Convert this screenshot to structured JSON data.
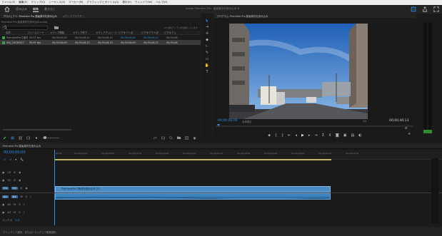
{
  "menu": [
    "ファイル(F)",
    "編集(E)",
    "クリップ(C)",
    "シーケンス(S)",
    "マーカー(M)",
    "グラフィックとタイトル(G)",
    "表示(V)",
    "ウィンドウ(W)",
    "ヘルプ(H)"
  ],
  "workspace": {
    "tabs": [
      "読み込み",
      "編集",
      "書き出し"
    ],
    "active": 1
  },
  "app_title": "Adobe Premiere Pro - 動画素材を読み込み ★",
  "project": {
    "tab": "プロジェクト: Premiere Pro 動画素材を読み込み",
    "tab2": "メディアブラウザー",
    "path": "Premiere Pro 動画素材を読み込み.prproj",
    "search_placeholder": "",
    "selected_info": "1/2 個のアイテムを選択しています",
    "columns": [
      "名前",
      "フレームレート",
      "メディア開始",
      "メディア終了",
      "メディアデュレーション",
      "ビデオイン点",
      "ビデオアウト点",
      "ビデオデュ"
    ],
    "rows": [
      {
        "name": "PremiereProで素材を読み込み",
        "color": "#2aa84a",
        "cells": [
          "29.97 fps",
          "00;00;00;00",
          "00;00;40;12",
          "00;00;40;13",
          "00;00;00;00",
          "00;00;40;12",
          "00;00;40;"
        ]
      },
      {
        "name": "VID_20230917",
        "color": "#3a9b52",
        "cells": [
          "29.97 fps",
          "00;00;00;00",
          "00;00;40;12",
          "00;00;40;13",
          "00;00;00;00",
          "00;00;40;12",
          "00;00;40;"
        ]
      }
    ]
  },
  "program": {
    "tab": "プログラム: Premiere Pro 動画素材を読み込み",
    "timecode": "00;00;00;00",
    "fit": "全体表示",
    "quality": "1/2",
    "duration": "00;00;40;13"
  },
  "timeline": {
    "tab": "Premiere Pro 動画素材を読み込み",
    "timecode": "00;00;00;00",
    "ruler": [
      "00;00",
      "00;00;04;00",
      "00;00;08;00",
      "00;00;12;00",
      "00;00;16;00",
      "00;00;20;00",
      "00;00;24;00",
      "00;00;28;00",
      "00;00;32;00",
      "00;00;36;00",
      "00;00;40;00",
      "00;00;44;00"
    ],
    "video_tracks": [
      "V3",
      "V2",
      "V1"
    ],
    "audio_tracks": [
      "A1",
      "A2",
      "A3"
    ],
    "clip_name": "PremiereProで素材を読み込み [V]",
    "mix": "ミックス",
    "mix_value": "0.0"
  },
  "status_bar": "クリックして選択、またはドラッグして範囲選択。",
  "colors": {
    "accent": "#2d8ceb",
    "clip_video": "#4b8cc4",
    "clip_audio": "#3b83c0",
    "workarea": "#c9b457"
  }
}
